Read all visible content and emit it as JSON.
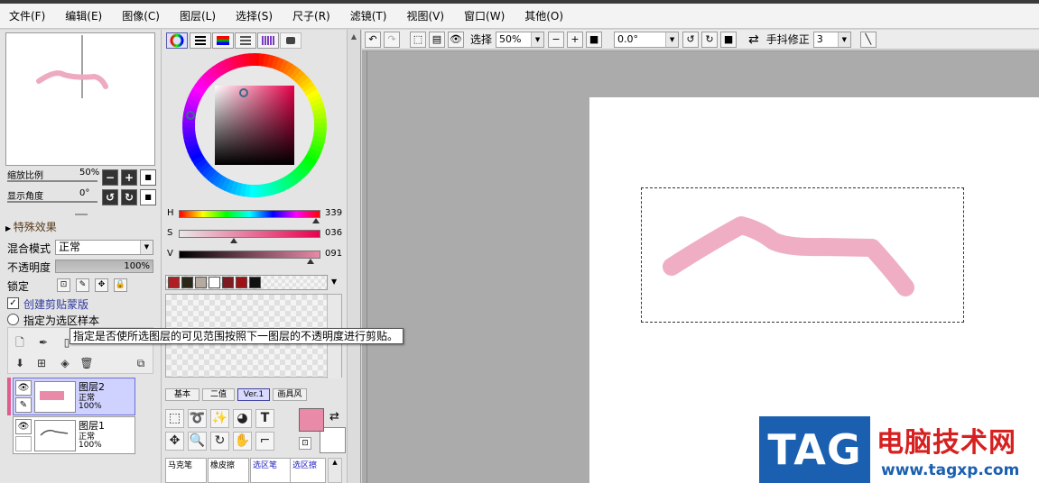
{
  "menu": [
    "文件(F)",
    "编辑(E)",
    "图像(C)",
    "图层(L)",
    "选择(S)",
    "尺子(R)",
    "滤镜(T)",
    "视图(V)",
    "窗口(W)",
    "其他(O)"
  ],
  "navigator": {
    "zoom_label": "缩放比例",
    "zoom_value": "50%",
    "angle_label": "显示角度",
    "angle_value": "0°"
  },
  "effects": {
    "title": "特殊效果"
  },
  "layer_props": {
    "blend_label": "混合模式",
    "blend_value": "正常",
    "opacity_label": "不透明度",
    "opacity_value": "100%",
    "lock_label": "锁定",
    "clipping_label": "创建剪贴蒙版",
    "clipping_checked": true,
    "selection_source_label": "指定为选区样本"
  },
  "tooltip": "指定是否使所选图层的可见范围按照下一图层的不透明度进行剪贴。",
  "layers": [
    {
      "name": "图层2",
      "mode": "正常",
      "opacity": "100%",
      "active": true
    },
    {
      "name": "图层1",
      "mode": "正常",
      "opacity": "100%",
      "active": false
    }
  ],
  "color": {
    "h_label": "H",
    "h_value": "339",
    "h_fraction": 0.94,
    "s_label": "S",
    "s_value": "036",
    "s_fraction": 0.36,
    "v_label": "V",
    "v_value": "091",
    "v_fraction": 0.91,
    "current_hex": "#e88aa8",
    "swatches": [
      "#b01e24",
      "#2a2618",
      "#b4aaa0",
      "#ffffff",
      "#7e1a22",
      "#9e1216",
      "#111111"
    ]
  },
  "tool_tabs": [
    "基本",
    "二值",
    "Ver.1",
    "画具风"
  ],
  "brush_tiles": [
    "马克笔",
    "橡皮擦",
    "选区笔",
    "选区擦"
  ],
  "toolbar": {
    "select_label": "选择",
    "zoom_value": "50%",
    "angle_value": "0.0°",
    "stabilizer_label": "手抖修正",
    "stabilizer_value": "3"
  },
  "watermark": {
    "tag": "TAG",
    "site_name": "电脑技术网",
    "url": "www.tagxp.com"
  },
  "stroke_color": "#eeaac0"
}
